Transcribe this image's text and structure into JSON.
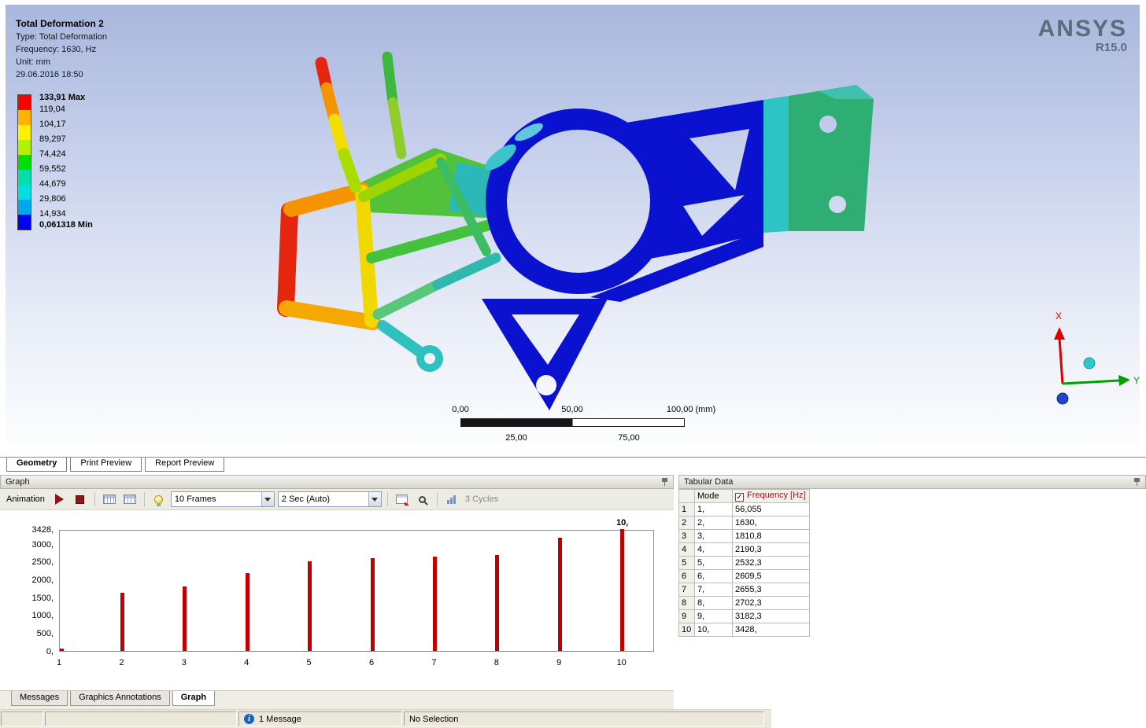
{
  "viewport": {
    "annotation": {
      "title": "Total Deformation 2",
      "type": "Type: Total Deformation",
      "frequency": "Frequency: 1630, Hz",
      "unit": "Unit: mm",
      "date": "29.06.2016 18:50"
    },
    "legend": {
      "entries": [
        {
          "label": "133,91 Max",
          "bold": true
        },
        {
          "label": "119,04",
          "bold": false
        },
        {
          "label": "104,17",
          "bold": false
        },
        {
          "label": "89,297",
          "bold": false
        },
        {
          "label": "74,424",
          "bold": false
        },
        {
          "label": "59,552",
          "bold": false
        },
        {
          "label": "44,679",
          "bold": false
        },
        {
          "label": "29,806",
          "bold": false
        },
        {
          "label": "14,934",
          "bold": false
        },
        {
          "label": "0,061318 Min",
          "bold": true
        }
      ],
      "band_colors": [
        "#ff0000",
        "#ffb200",
        "#fff200",
        "#b2f200",
        "#00e000",
        "#00e0a8",
        "#00e0e0",
        "#00a8f0",
        "#0000f0"
      ]
    },
    "brand": {
      "name": "ANSYS",
      "version": "R15.0"
    },
    "ruler": {
      "top_labels": [
        "0,00",
        "50,00",
        "100,00 (mm)"
      ],
      "bottom_labels": [
        "25,00",
        "75,00"
      ]
    },
    "triad": {
      "x": "X",
      "y": "Y"
    }
  },
  "view_tabs": [
    {
      "label": "Geometry",
      "active": true
    },
    {
      "label": "Print Preview",
      "active": false
    },
    {
      "label": "Report Preview",
      "active": false
    }
  ],
  "graph": {
    "panel_title": "Graph",
    "toolbar": {
      "animation_label": "Animation",
      "frames_dropdown": "10 Frames",
      "duration_dropdown": "2 Sec (Auto)",
      "cycles_label": "3 Cycles"
    },
    "chart_data": {
      "type": "bar",
      "categories": [
        "1",
        "2",
        "3",
        "4",
        "5",
        "6",
        "7",
        "8",
        "9",
        "10"
      ],
      "values": [
        56.055,
        1630,
        1810.8,
        2190.3,
        2532.3,
        2609.5,
        2655.3,
        2702.3,
        3182.3,
        3428
      ],
      "title": "",
      "xlabel": "",
      "ylabel": "",
      "ylim": [
        0,
        3428
      ],
      "ytick_values": [
        3428,
        3000,
        2500,
        2000,
        1500,
        1000,
        500,
        0
      ],
      "ytick_labels": [
        "3428,",
        "3000,",
        "2500,",
        "2000,",
        "1500,",
        "1000,",
        "500,",
        "0,"
      ],
      "bar_color": "#c00000",
      "peak_annotation": "10,",
      "grid": false,
      "legend_position": "none"
    }
  },
  "tabular": {
    "panel_title": "Tabular Data",
    "columns": [
      {
        "label": "Mode",
        "checked": false
      },
      {
        "label": "Frequency [Hz]",
        "checked": true
      }
    ],
    "rows": [
      {
        "num": "1",
        "mode": "1,",
        "freq": "56,055"
      },
      {
        "num": "2",
        "mode": "2,",
        "freq": "1630,"
      },
      {
        "num": "3",
        "mode": "3,",
        "freq": "1810,8"
      },
      {
        "num": "4",
        "mode": "4,",
        "freq": "2190,3"
      },
      {
        "num": "5",
        "mode": "5,",
        "freq": "2532,3"
      },
      {
        "num": "6",
        "mode": "6,",
        "freq": "2609,5"
      },
      {
        "num": "7",
        "mode": "7,",
        "freq": "2655,3"
      },
      {
        "num": "8",
        "mode": "8,",
        "freq": "2702,3"
      },
      {
        "num": "9",
        "mode": "9,",
        "freq": "3182,3"
      },
      {
        "num": "10",
        "mode": "10,",
        "freq": "3428,"
      }
    ]
  },
  "bottom_tabs": [
    {
      "label": "Messages",
      "active": false
    },
    {
      "label": "Graphics Annotations",
      "active": false
    },
    {
      "label": "Graph",
      "active": true
    }
  ],
  "status_bar": {
    "message": "1 Message",
    "selection": "No Selection"
  }
}
